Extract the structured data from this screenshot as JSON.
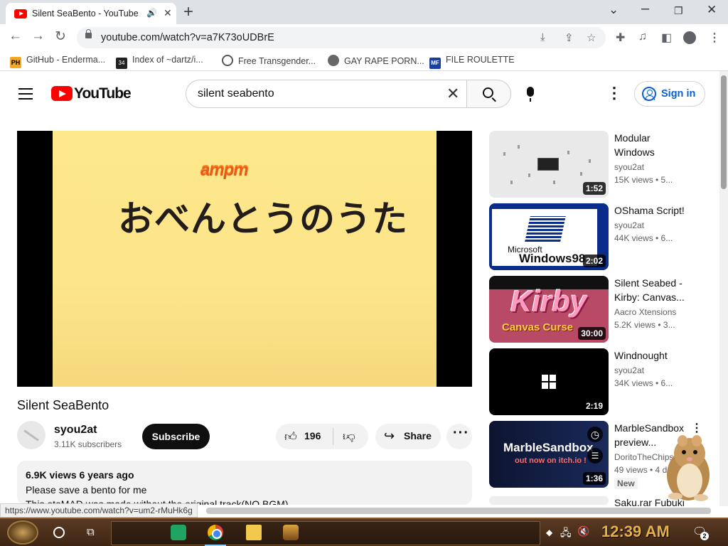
{
  "browser": {
    "tab": {
      "title": "Silent SeaBento - YouTube",
      "audio_icon": "speaker-icon",
      "close": "✕"
    },
    "new_tab": "+",
    "window_controls": {
      "minimize": "⌄",
      "restore": "🗗",
      "close": "✕"
    },
    "url": "youtube.com/watch?v=a7K73oUDBrE",
    "bookmarks": [
      {
        "label": "GitHub - Enderma...",
        "icon_color": "#f5a623",
        "icon_text": "PH"
      },
      {
        "label": "Index of ~dartz/i...",
        "icon_color": "#222222",
        "icon_text": "34"
      },
      {
        "label": "Free Transgender...",
        "icon_color": "#555555",
        "icon_text": ""
      },
      {
        "label": "GAY RAPE PORN...",
        "icon_color": "#666666",
        "icon_text": ""
      },
      {
        "label": "FILE ROULETTE",
        "icon_color": "#1a3fa0",
        "icon_text": "MF"
      }
    ]
  },
  "youtube": {
    "wordmark": "YouTube",
    "search": {
      "value": "silent seabento"
    },
    "sign_in": "Sign in",
    "video": {
      "frame_brand": "ampm",
      "frame_text": "おべんとうのうた",
      "title": "Silent SeaBento",
      "channel": "syou2at",
      "subscribers": "3.11K subscribers",
      "subscribe": "Subscribe",
      "likes": "196",
      "share": "Share",
      "more": "···",
      "stats": "6.9K views  6 years ago",
      "desc_line1": "Please save a bento for me",
      "desc_line2": "This otoMAD was made without the original track(NO BGM)"
    },
    "recommendations": [
      {
        "title": "Modular Windows",
        "channel": "syou2at",
        "meta": "15K views  •  5...",
        "duration": "1:52"
      },
      {
        "title": "OShama Script!",
        "channel": "syou2at",
        "meta": "44K views  •  6...",
        "duration": "2:02",
        "thumb_ms": "Microsoft",
        "thumb_win": "Windows98"
      },
      {
        "title": "Silent Seabed - Kirby: Canvas...",
        "channel": "Aacro Xtensions",
        "meta": "5.2K views  •  3...",
        "duration": "30:00",
        "thumb_kirby": "Kirby",
        "thumb_sub": "Canvas Curse"
      },
      {
        "title": "Windnought",
        "channel": "syou2at",
        "meta": "34K views  •  6...",
        "duration": "2:19"
      },
      {
        "title": "MarbleSandbox preview...",
        "channel": "DoritoTheChips",
        "meta": "49 views  •  4 d...",
        "duration": "1:36",
        "badge": "New",
        "thumb_title": "MarbleSandbox",
        "thumb_sub": "out now on itch.io !"
      },
      {
        "title": "Saku.rar Fubuki"
      }
    ]
  },
  "status_url": "https://www.youtube.com/watch?v=um2-rMuHk6g",
  "taskbar": {
    "clock": "12:39 AM",
    "notifications": "2"
  }
}
